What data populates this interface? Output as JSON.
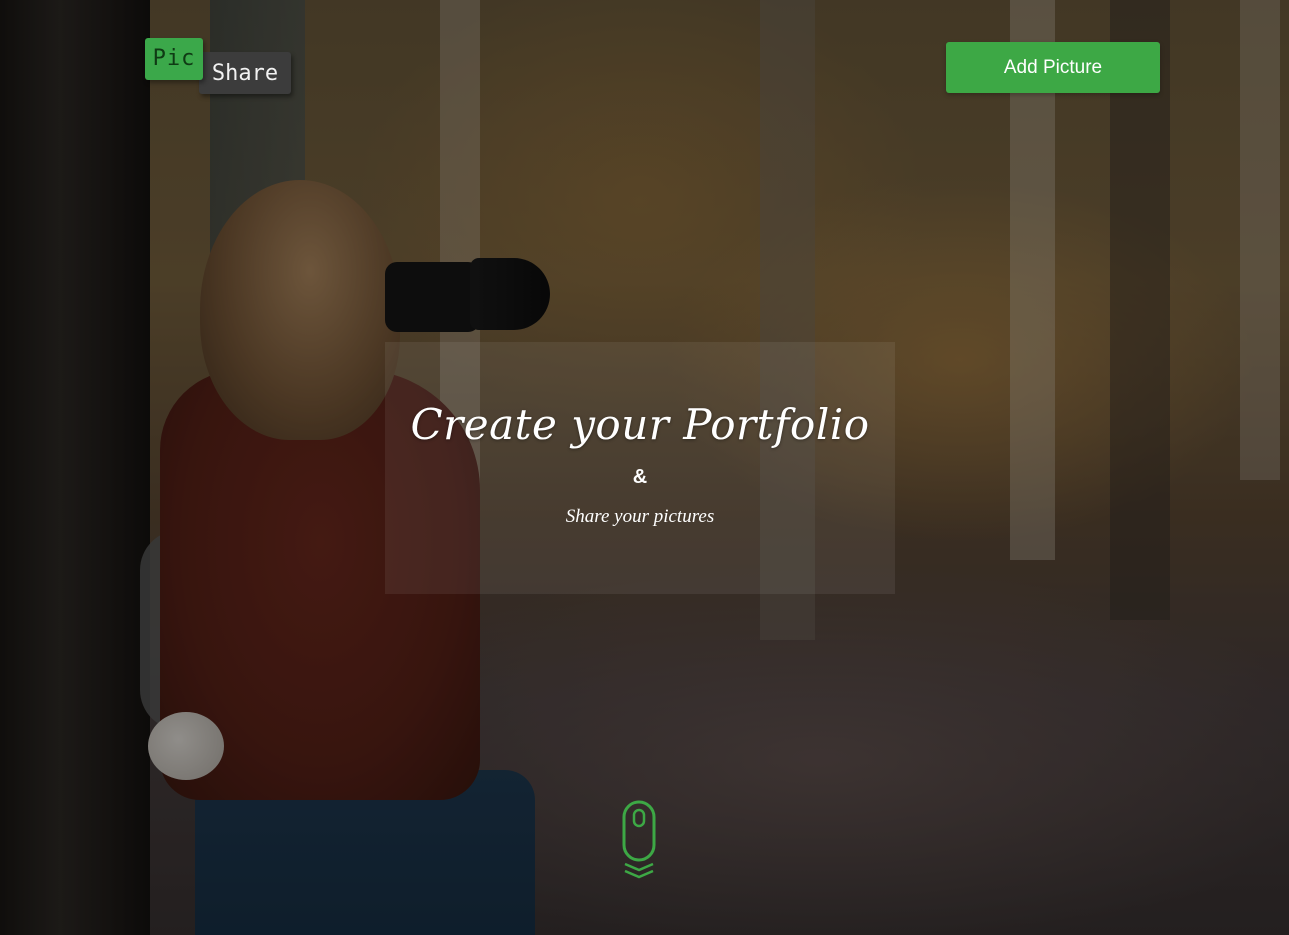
{
  "header": {
    "logo_part1": "Pic",
    "logo_part2": "Share",
    "add_button_label": "Add Picture"
  },
  "hero": {
    "headline": "Create your Portfolio",
    "ampersand": "&",
    "tagline": "Share your pictures"
  },
  "scroll_indicator": {
    "icon": "mouse-scroll-icon"
  },
  "colors": {
    "accent": "#3da845",
    "logo_dark": "#3c3c3c",
    "text": "#ffffff"
  }
}
